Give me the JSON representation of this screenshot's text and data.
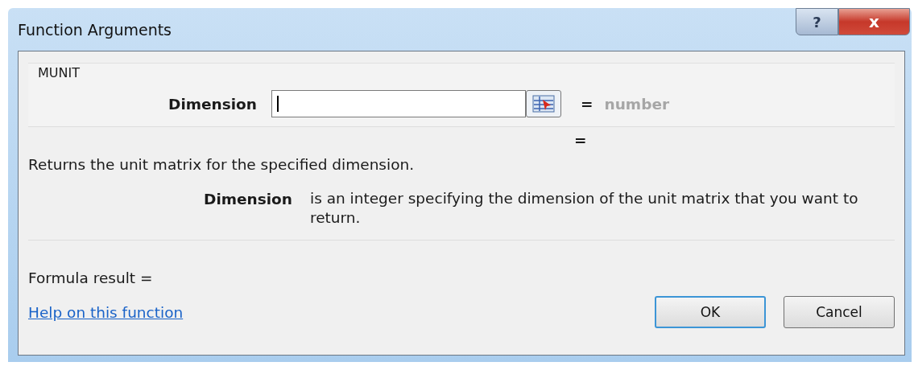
{
  "window": {
    "title": "Function Arguments",
    "title_buttons": [
      {
        "kind": "help",
        "label": "?"
      },
      {
        "kind": "close",
        "label": "x"
      }
    ]
  },
  "function_name": "MUNIT",
  "arguments": [
    {
      "label": "Dimension",
      "focused": true,
      "equals": "=",
      "hint": "number"
    }
  ],
  "result_equals": "=",
  "description": "Returns the unit matrix for the specified dimension.",
  "argument_help": {
    "name": "Dimension",
    "text": "is an integer specifying the dimension of the unit matrix that you want to return."
  },
  "formula_result": "Formula result =",
  "help_link": "Help on this function",
  "buttons": [
    {
      "label": "OK",
      "default": true
    },
    {
      "label": "Cancel",
      "default": false
    }
  ]
}
